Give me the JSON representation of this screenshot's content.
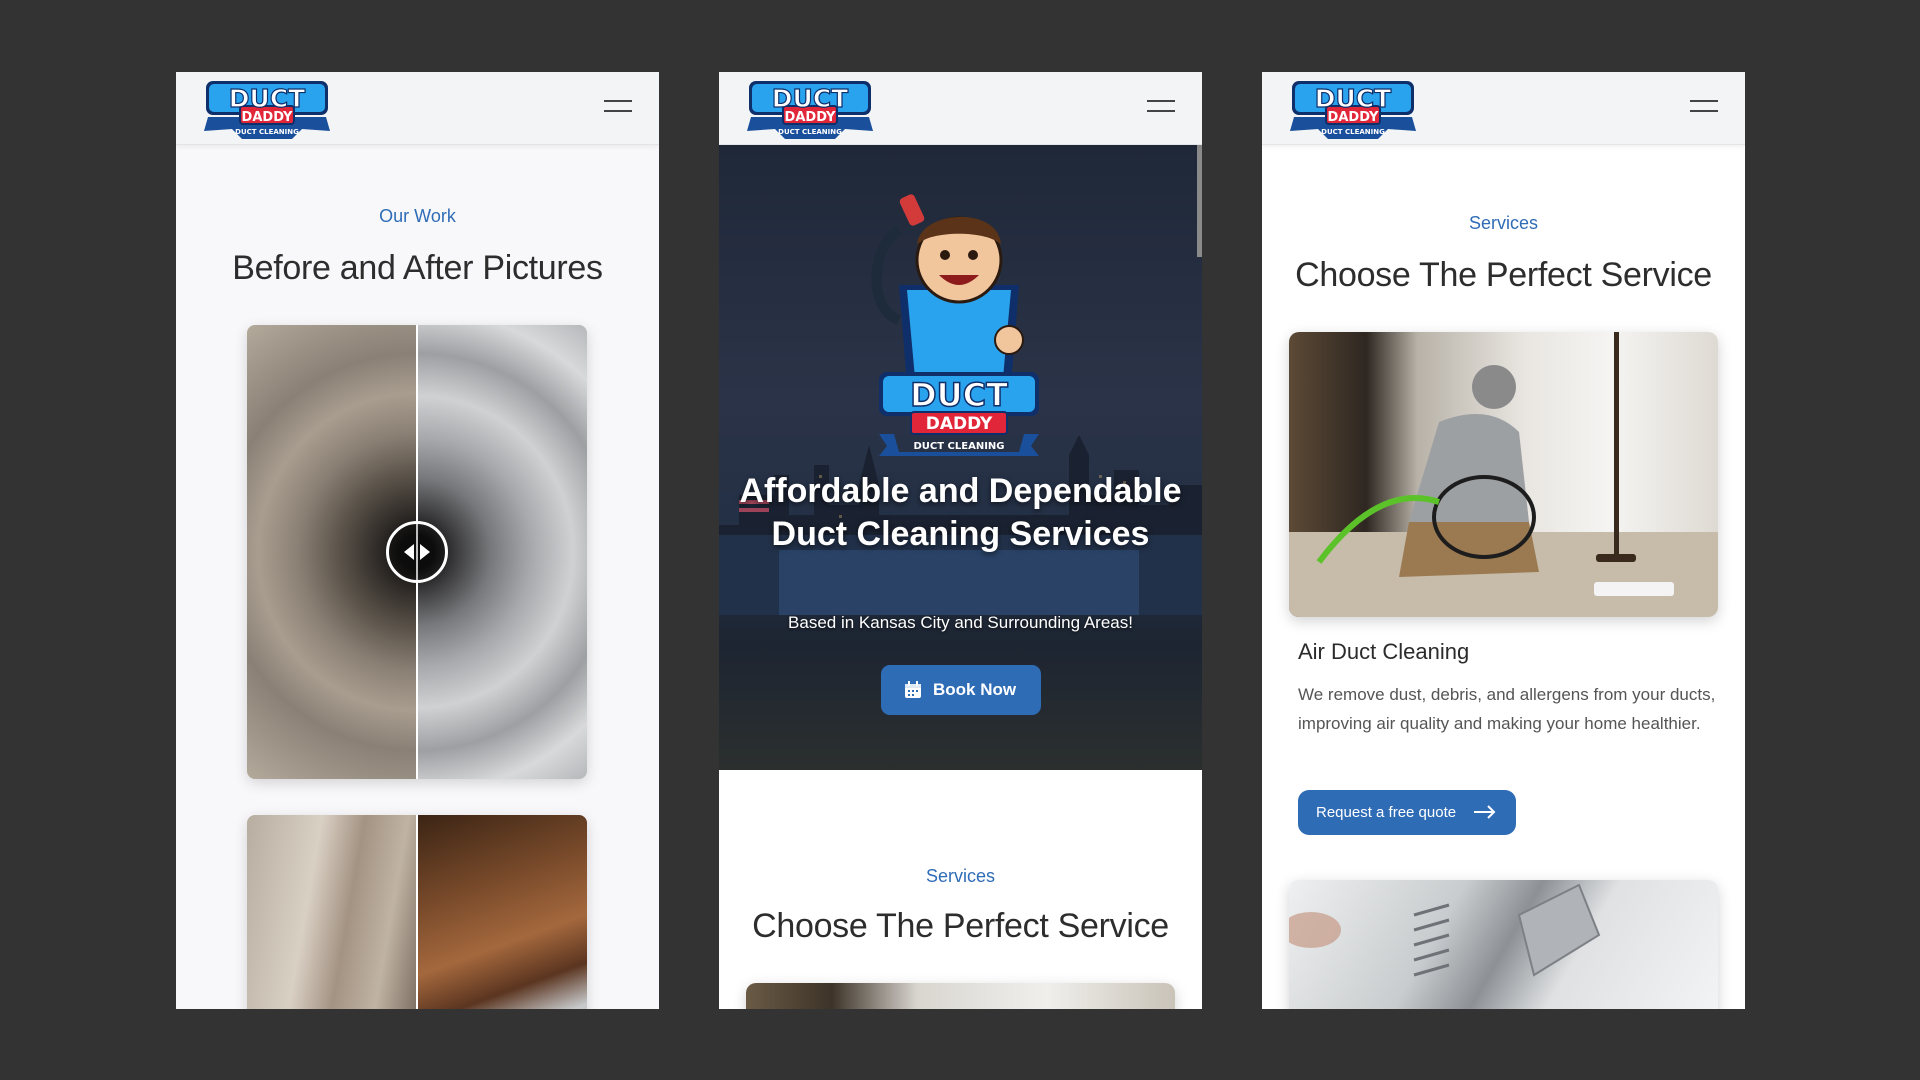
{
  "screens": [
    {
      "eyebrow": "Our Work",
      "title": "Before and After Pictures"
    },
    {
      "hero": {
        "title": "Affordable and Dependable Duct Cleaning Services",
        "subtitle": "Based in Kansas City and Surrounding Areas!",
        "button_label": "Book Now"
      },
      "eyebrow": "Services",
      "title": "Choose The Perfect Service"
    },
    {
      "eyebrow": "Services",
      "title": "Choose The Perfect Service",
      "card": {
        "title": "Air Duct Cleaning",
        "description": "We remove dust, debris, and allergens from your ducts, improving air quality and making your home healthier.",
        "button_label": "Request a free quote"
      }
    }
  ],
  "brand": {
    "name_line1": "DUCT",
    "name_line2": "DADDY",
    "tagline": "DUCT CLEANING"
  },
  "colors": {
    "background": "#333333",
    "accent": "#2f6cb6",
    "logo_blue": "#1f8fe0",
    "logo_red": "#e2263a"
  },
  "icons": [
    "hamburger-menu-icon",
    "calendar-icon",
    "arrow-right-icon",
    "left-right-arrows-icon"
  ]
}
